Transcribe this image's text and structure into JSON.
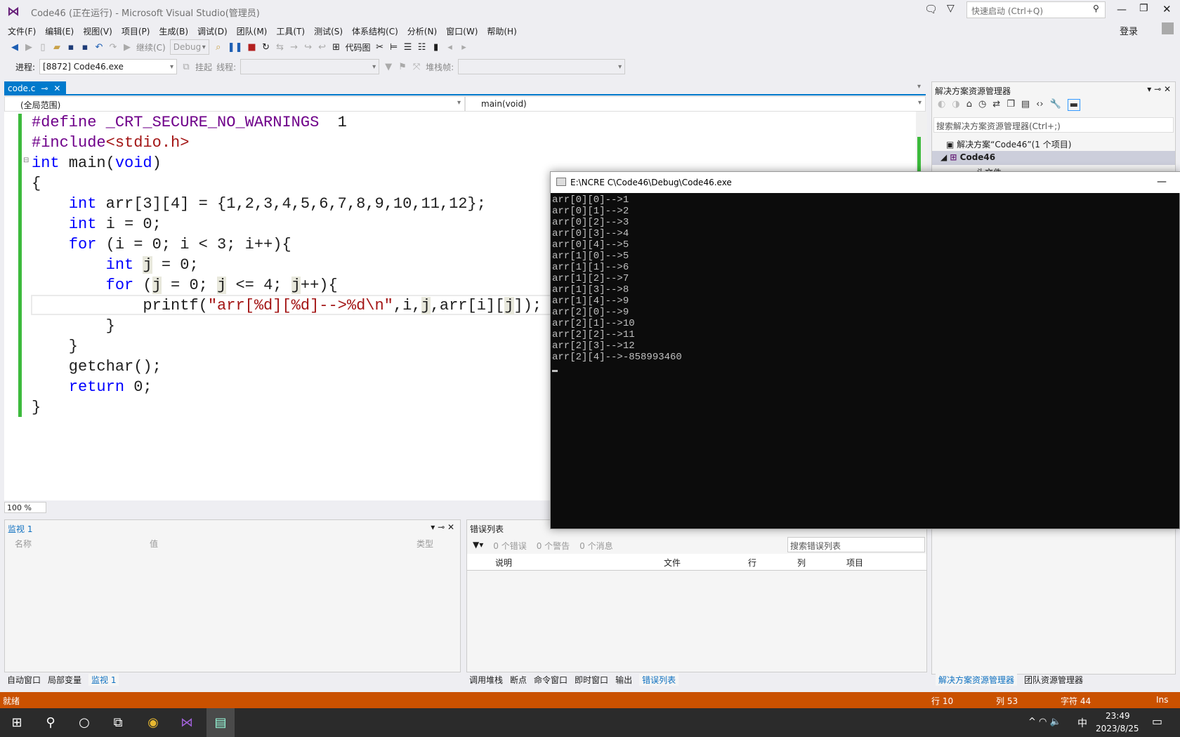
{
  "window": {
    "title": "Code46 (正在运行) - Microsoft Visual Studio(管理员)",
    "quick_launch": "快速启动 (Ctrl+Q)",
    "login": "登录"
  },
  "menu": [
    "文件(F)",
    "编辑(E)",
    "视图(V)",
    "项目(P)",
    "生成(B)",
    "调试(D)",
    "团队(M)",
    "工具(T)",
    "测试(S)",
    "体系结构(C)",
    "分析(N)",
    "窗口(W)",
    "帮助(H)"
  ],
  "toolbar": {
    "continue": "继续(C)",
    "config": "Debug",
    "codemap": "代码图",
    "process_label": "进程:",
    "process": "[8872] Code46.exe",
    "suspend": "挂起",
    "thread_label": "线程:",
    "stackframe_label": "堆栈帧:"
  },
  "editor": {
    "tab": "code.c",
    "scope": "(全局范围)",
    "function": "main(void)",
    "zoom": "100 %",
    "lines": [
      [
        [
          "mac",
          "#define "
        ],
        [
          "mac",
          "_CRT_SECURE_NO_WARNINGS"
        ],
        [
          "",
          "  1"
        ]
      ],
      [
        [
          "mac",
          "#include"
        ],
        [
          "str",
          "<stdio.h>"
        ]
      ],
      [
        [
          "kw",
          "int"
        ],
        [
          "",
          " main("
        ],
        [
          "kw",
          "void"
        ],
        [
          "",
          ")"
        ]
      ],
      [
        [
          "",
          "{"
        ]
      ],
      [
        [
          "",
          "    "
        ],
        [
          "kw",
          "int"
        ],
        [
          "",
          " arr[3][4] = {1,2,3,4,5,6,7,8,9,10,11,12};"
        ]
      ],
      [
        [
          "",
          "    "
        ],
        [
          "kw",
          "int"
        ],
        [
          "",
          " i = 0;"
        ]
      ],
      [
        [
          "",
          "    "
        ],
        [
          "kw",
          "for"
        ],
        [
          "",
          " (i = 0; i < 3; i++){"
        ]
      ],
      [
        [
          "",
          "        "
        ],
        [
          "kw",
          "int"
        ],
        [
          "",
          " "
        ],
        [
          "hl",
          "j"
        ],
        [
          "",
          " = 0;"
        ]
      ],
      [
        [
          "",
          "        "
        ],
        [
          "kw",
          "for"
        ],
        [
          "",
          " ("
        ],
        [
          "hl",
          "j"
        ],
        [
          "",
          " = 0; "
        ],
        [
          "hl",
          "j"
        ],
        [
          "",
          " <= 4; "
        ],
        [
          "hl",
          "j"
        ],
        [
          "",
          "++){"
        ]
      ],
      [
        [
          "",
          "            printf("
        ],
        [
          "str",
          "\"arr[%d][%d]-->%d\\n\""
        ],
        [
          "",
          ",i,"
        ],
        [
          "hl",
          "j"
        ],
        [
          "",
          ",arr[i]["
        ],
        [
          "hl",
          "j"
        ],
        [
          "",
          "]);"
        ]
      ],
      [
        [
          "",
          "        }"
        ]
      ],
      [
        [
          "",
          "    }"
        ]
      ],
      [
        [
          "",
          "    getchar();"
        ]
      ],
      [
        [
          "",
          "    "
        ],
        [
          "kw",
          "return"
        ],
        [
          "",
          " 0;"
        ]
      ],
      [
        [
          "",
          "}"
        ]
      ]
    ]
  },
  "console": {
    "title": "E:\\NCRE C\\Code46\\Debug\\Code46.exe",
    "output": [
      "arr[0][0]-->1",
      "arr[0][1]-->2",
      "arr[0][2]-->3",
      "arr[0][3]-->4",
      "arr[0][4]-->5",
      "arr[1][0]-->5",
      "arr[1][1]-->6",
      "arr[1][2]-->7",
      "arr[1][3]-->8",
      "arr[1][4]-->9",
      "arr[2][0]-->9",
      "arr[2][1]-->10",
      "arr[2][2]-->11",
      "arr[2][3]-->12",
      "arr[2][4]-->-858993460"
    ]
  },
  "watch": {
    "title": "监视 1",
    "cols": [
      "名称",
      "值",
      "类型"
    ],
    "tabs": [
      "自动窗口",
      "局部变量",
      "监视 1"
    ]
  },
  "errors": {
    "title": "错误列表",
    "errors": "0 个错误",
    "warnings": "0 个警告",
    "messages": "0 个消息",
    "search": "搜索错误列表",
    "cols": [
      "说明",
      "文件",
      "行",
      "列",
      "项目"
    ],
    "tabs": [
      "调用堆栈",
      "断点",
      "命令窗口",
      "即时窗口",
      "输出",
      "错误列表"
    ]
  },
  "solution": {
    "title": "解决方案资源管理器",
    "search": "搜索解决方案资源管理器(Ctrl+;)",
    "root": "解决方案“Code46”(1 个项目)",
    "project": "Code46",
    "folder": "头文件",
    "tabs": [
      "解决方案资源管理器",
      "团队资源管理器"
    ]
  },
  "status": {
    "ready": "就绪",
    "line": "行 10",
    "col": "列 53",
    "char": "字符 44",
    "mode": "Ins"
  },
  "taskbar": {
    "time": "23:49",
    "date": "2023/8/25",
    "ime": "中"
  },
  "colors": {
    "accent": "#007acc",
    "status": "#ca5100"
  }
}
